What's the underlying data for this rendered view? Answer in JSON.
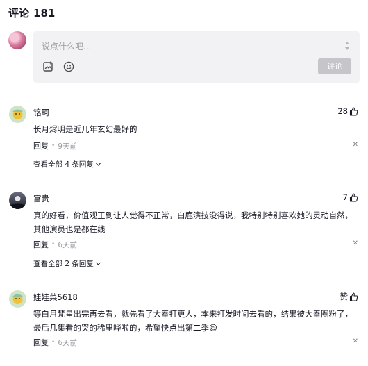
{
  "header": {
    "title": "评论",
    "count": "181"
  },
  "composer": {
    "placeholder": "说点什么吧...",
    "submit_label": "评论"
  },
  "comments": [
    {
      "name": "铭珂",
      "likes": "28",
      "text": "长月烬明是近几年玄幻最好的",
      "reply_label": "回复",
      "time": "9天前",
      "view_replies": "查看全部 4 条回复"
    },
    {
      "name": "富贵",
      "likes": "7",
      "text": "真的好看，价值观正到让人觉得不正常，白鹿演技没得说，我特别特别喜欢她的灵动自然，其他演员也是都在线",
      "reply_label": "回复",
      "time": "6天前",
      "view_replies": "查看全部 2 条回复"
    },
    {
      "name": "娃娃菜5618",
      "likes": "赞",
      "text": "等白月梵星出完再去看，就先看了大奉打更人，本来打发时间去看的，结果被大奉圈粉了，最后几集看的哭的稀里哗啦的，希望快点出第二季😄",
      "reply_label": "回复",
      "time": "6天前"
    }
  ]
}
